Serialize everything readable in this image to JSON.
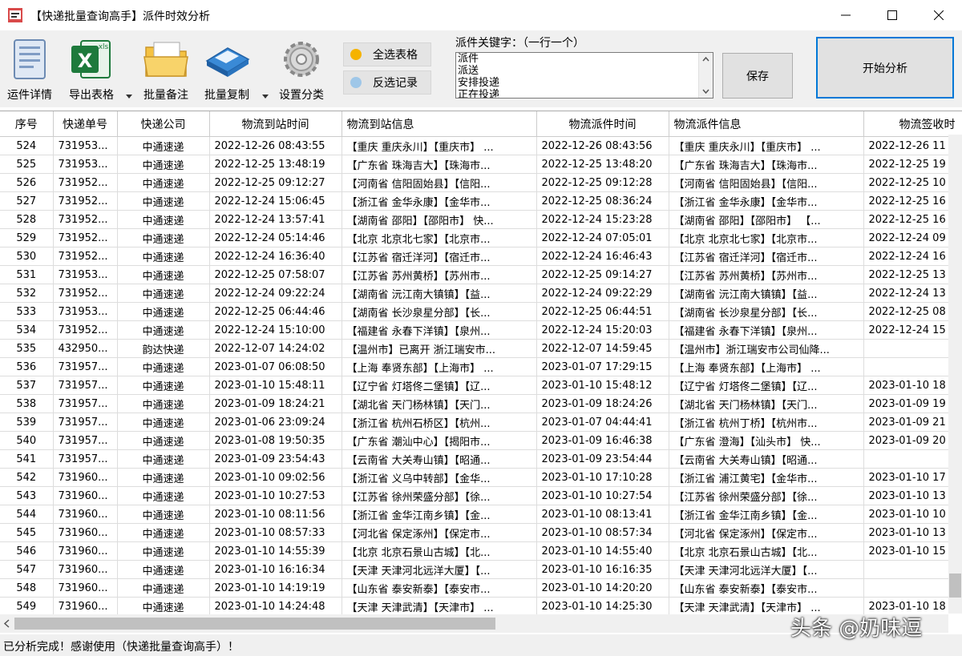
{
  "window": {
    "title": "【快递批量查询高手】派件时效分析"
  },
  "toolbar": {
    "detail_label": "运件详情",
    "export_label": "导出表格",
    "note_label": "批量备注",
    "copy_label": "批量复制",
    "settings_label": "设置分类",
    "select_all_label": "全选表格",
    "invert_label": "反选记录",
    "keyword_label": "派件关键字：（一行一个）",
    "keywords": [
      "派件",
      "派送",
      "安排投递",
      "正在投递"
    ],
    "save_label": "保存",
    "start_label": "开始分析"
  },
  "table": {
    "columns": [
      "序号",
      "快递单号",
      "快递公司",
      "物流到站时间",
      "物流到站信息",
      "物流派件时间",
      "物流派件信息",
      "物流签收时"
    ],
    "rows": [
      [
        "524",
        "731953...",
        "中通速递",
        "2022-12-26 08:43:55",
        "【重庆 重庆永川】【重庆市】 ...",
        "2022-12-26 08:43:56",
        "【重庆 重庆永川】【重庆市】 ...",
        "2022-12-26 11"
      ],
      [
        "525",
        "731953...",
        "中通速递",
        "2022-12-25 13:48:19",
        "【广东省 珠海吉大】【珠海市...",
        "2022-12-25 13:48:20",
        "【广东省 珠海吉大】【珠海市...",
        "2022-12-25 19"
      ],
      [
        "526",
        "731952...",
        "中通速递",
        "2022-12-25 09:12:27",
        "【河南省 信阳固始县】【信阳...",
        "2022-12-25 09:12:28",
        "【河南省 信阳固始县】【信阳...",
        "2022-12-25 10"
      ],
      [
        "527",
        "731952...",
        "中通速递",
        "2022-12-24 15:06:45",
        "【浙江省 金华永康】【金华市...",
        "2022-12-25 08:36:24",
        "【浙江省 金华永康】【金华市...",
        "2022-12-25 16"
      ],
      [
        "528",
        "731952...",
        "中通速递",
        "2022-12-24 13:57:41",
        "【湖南省 邵阳】【邵阳市】 快...",
        "2022-12-24 15:23:28",
        "【湖南省 邵阳】【邵阳市】 【...",
        "2022-12-25 16"
      ],
      [
        "529",
        "731952...",
        "中通速递",
        "2022-12-24 05:14:46",
        "【北京 北京北七家】【北京市...",
        "2022-12-24 07:05:01",
        "【北京 北京北七家】【北京市...",
        "2022-12-24 09"
      ],
      [
        "530",
        "731952...",
        "中通速递",
        "2022-12-24 16:36:40",
        "【江苏省 宿迁洋河】【宿迁市...",
        "2022-12-24 16:46:43",
        "【江苏省 宿迁洋河】【宿迁市...",
        "2022-12-24 16"
      ],
      [
        "531",
        "731953...",
        "中通速递",
        "2022-12-25 07:58:07",
        "【江苏省 苏州黄桥】【苏州市...",
        "2022-12-25 09:14:27",
        "【江苏省 苏州黄桥】【苏州市...",
        "2022-12-25 13"
      ],
      [
        "532",
        "731952...",
        "中通速递",
        "2022-12-24 09:22:24",
        "【湖南省 沅江南大镇镇】【益...",
        "2022-12-24 09:22:29",
        "【湖南省 沅江南大镇镇】【益...",
        "2022-12-24 13"
      ],
      [
        "533",
        "731953...",
        "中通速递",
        "2022-12-25 06:44:46",
        "【湖南省 长沙泉星分部】【长...",
        "2022-12-25 06:44:51",
        "【湖南省 长沙泉星分部】【长...",
        "2022-12-25 08"
      ],
      [
        "534",
        "731952...",
        "中通速递",
        "2022-12-24 15:10:00",
        "【福建省 永春下洋镇】【泉州...",
        "2022-12-24 15:20:03",
        "【福建省 永春下洋镇】【泉州...",
        "2022-12-24 15"
      ],
      [
        "535",
        "432950...",
        "韵达快递",
        "2022-12-07 14:24:02",
        "【温州市】已离开 浙江瑞安市...",
        "2022-12-07 14:59:45",
        "【温州市】浙江瑞安市公司仙降...",
        ""
      ],
      [
        "536",
        "731957...",
        "中通速递",
        "2023-01-07 06:08:50",
        "【上海 奉贤东部】【上海市】 ...",
        "2023-01-07 17:29:15",
        "【上海 奉贤东部】【上海市】 ...",
        ""
      ],
      [
        "537",
        "731957...",
        "中通速递",
        "2023-01-10 15:48:11",
        "【辽宁省 灯塔佟二堡镇】【辽...",
        "2023-01-10 15:48:12",
        "【辽宁省 灯塔佟二堡镇】【辽...",
        "2023-01-10 18"
      ],
      [
        "538",
        "731957...",
        "中通速递",
        "2023-01-09 18:24:21",
        "【湖北省 天门杨林镇】【天门...",
        "2023-01-09 18:24:26",
        "【湖北省 天门杨林镇】【天门...",
        "2023-01-09 19"
      ],
      [
        "539",
        "731957...",
        "中通速递",
        "2023-01-06 23:09:24",
        "【浙江省 杭州石桥区】【杭州...",
        "2023-01-07 04:44:41",
        "【浙江省 杭州丁桥】【杭州市...",
        "2023-01-09 21"
      ],
      [
        "540",
        "731957...",
        "中通速递",
        "2023-01-08 19:50:35",
        "【广东省 潮汕中心】【揭阳市...",
        "2023-01-09 16:46:38",
        "【广东省 澄海】【汕头市】 快...",
        "2023-01-09 20"
      ],
      [
        "541",
        "731957...",
        "中通速递",
        "2023-01-09 23:54:43",
        "【云南省 大关寿山镇】【昭通...",
        "2023-01-09 23:54:44",
        "【云南省 大关寿山镇】【昭通...",
        ""
      ],
      [
        "542",
        "731960...",
        "中通速递",
        "2023-01-10 09:02:56",
        "【浙江省 义乌中转部】【金华...",
        "2023-01-10 17:10:28",
        "【浙江省 浦江黄宅】【金华市...",
        "2023-01-10 17"
      ],
      [
        "543",
        "731960...",
        "中通速递",
        "2023-01-10 10:27:53",
        "【江苏省 徐州荣盛分部】【徐...",
        "2023-01-10 10:27:54",
        "【江苏省 徐州荣盛分部】【徐...",
        "2023-01-10 13"
      ],
      [
        "544",
        "731960...",
        "中通速递",
        "2023-01-10 08:11:56",
        "【浙江省 金华江南乡镇】【金...",
        "2023-01-10 08:13:41",
        "【浙江省 金华江南乡镇】【金...",
        "2023-01-10 10"
      ],
      [
        "545",
        "731960...",
        "中通速递",
        "2023-01-10 08:57:33",
        "【河北省 保定涿州】【保定市...",
        "2023-01-10 08:57:34",
        "【河北省 保定涿州】【保定市...",
        "2023-01-10 13"
      ],
      [
        "546",
        "731960...",
        "中通速递",
        "2023-01-10 14:55:39",
        "【北京 北京石景山古城】【北...",
        "2023-01-10 14:55:40",
        "【北京 北京石景山古城】【北...",
        "2023-01-10 15"
      ],
      [
        "547",
        "731960...",
        "中通速递",
        "2023-01-10 16:16:34",
        "【天津 天津河北远洋大厦】【...",
        "2023-01-10 16:16:35",
        "【天津 天津河北远洋大厦】【...",
        ""
      ],
      [
        "548",
        "731960...",
        "中通速递",
        "2023-01-10 14:19:19",
        "【山东省 泰安新泰】【泰安市...",
        "2023-01-10 14:20:20",
        "【山东省 泰安新泰】【泰安市...",
        ""
      ],
      [
        "549",
        "731960...",
        "中通速递",
        "2023-01-10 14:24:48",
        "【天津 天津武清】【天津市】 ...",
        "2023-01-10 14:25:30",
        "【天津 天津武清】【天津市】 ...",
        "2023-01-10 18"
      ]
    ]
  },
  "status": {
    "text": "已分析完成！感谢使用（快递批量查询高手）！"
  },
  "watermark": {
    "text": "头条 @奶味逗"
  },
  "colors": {
    "accent": "#0078d7",
    "excel_green": "#1e7a3c",
    "folder_yellow": "#f5c242",
    "toolbar_bg": "#f0f0f0"
  }
}
